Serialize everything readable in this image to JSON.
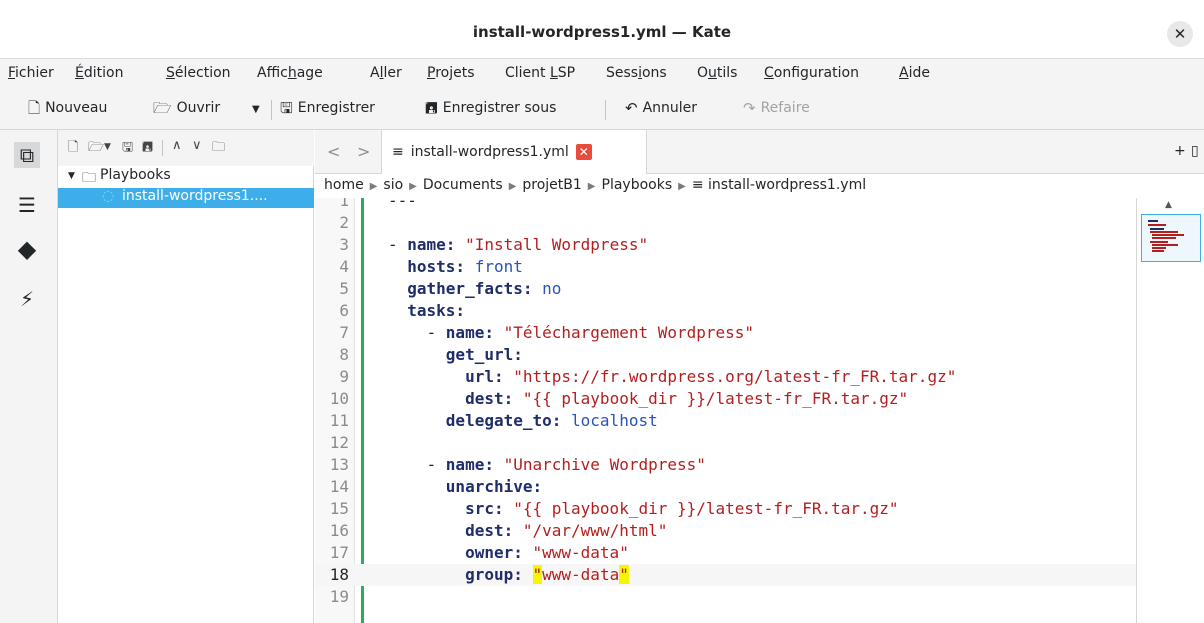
{
  "window": {
    "title": "install-wordpress1.yml — Kate"
  },
  "menubar": [
    {
      "pre": "",
      "ul": "F",
      "post": "ichier"
    },
    {
      "pre": "",
      "ul": "É",
      "post": "dition"
    },
    {
      "pre": "",
      "ul": "S",
      "post": "élection"
    },
    {
      "pre": "Affic",
      "ul": "h",
      "post": "age"
    },
    {
      "pre": "A",
      "ul": "l",
      "post": "ler"
    },
    {
      "pre": "",
      "ul": "P",
      "post": "rojets"
    },
    {
      "pre": "Client ",
      "ul": "L",
      "post": "SP"
    },
    {
      "pre": "Sess",
      "ul": "i",
      "post": "ons"
    },
    {
      "pre": "O",
      "ul": "u",
      "post": "tils"
    },
    {
      "pre": "",
      "ul": "C",
      "post": "onfiguration"
    },
    {
      "pre": "",
      "ul": "A",
      "post": "ide"
    }
  ],
  "toolbar": {
    "new_label": "Nouveau",
    "open_label": "Ouvrir",
    "save_label": "Enregistrer",
    "save_as_label": "Enregistrer sous",
    "undo_label": "Annuler",
    "redo_label": "Refaire"
  },
  "tree": {
    "folder": "Playbooks",
    "file": "install-wordpress1...."
  },
  "tab": {
    "label": "install-wordpress1.yml"
  },
  "breadcrumb": [
    "home",
    "sio",
    "Documents",
    "projetB1",
    "Playbooks",
    "install-wordpress1.yml"
  ],
  "editor": {
    "current_line": 18,
    "lines": [
      [
        {
          "t": "---",
          "c": "p"
        }
      ],
      [],
      [
        {
          "t": "- ",
          "c": "p"
        },
        {
          "t": "name:",
          "c": "k"
        },
        {
          "t": " \"Install Wordpress\"",
          "c": "s"
        }
      ],
      [
        {
          "t": "  hosts:",
          "c": "k"
        },
        {
          "t": " front",
          "c": "v"
        }
      ],
      [
        {
          "t": "  gather_facts:",
          "c": "k"
        },
        {
          "t": " no",
          "c": "v"
        }
      ],
      [
        {
          "t": "  tasks:",
          "c": "k"
        }
      ],
      [
        {
          "t": "    - ",
          "c": "p"
        },
        {
          "t": "name:",
          "c": "k"
        },
        {
          "t": " \"Téléchargement Wordpress\"",
          "c": "s"
        }
      ],
      [
        {
          "t": "      get_url:",
          "c": "k"
        }
      ],
      [
        {
          "t": "        url:",
          "c": "k"
        },
        {
          "t": " \"https://fr.wordpress.org/latest-fr_FR.tar.gz\"",
          "c": "s"
        }
      ],
      [
        {
          "t": "        dest:",
          "c": "k"
        },
        {
          "t": " \"{{ playbook_dir }}/latest-fr_FR.tar.gz\"",
          "c": "s"
        }
      ],
      [
        {
          "t": "      delegate_to:",
          "c": "k"
        },
        {
          "t": " localhost",
          "c": "v"
        }
      ],
      [],
      [
        {
          "t": "    - ",
          "c": "p"
        },
        {
          "t": "name:",
          "c": "k"
        },
        {
          "t": " \"Unarchive Wordpress\"",
          "c": "s"
        }
      ],
      [
        {
          "t": "      unarchive:",
          "c": "k"
        }
      ],
      [
        {
          "t": "        src:",
          "c": "k"
        },
        {
          "t": " \"{{ playbook_dir }}/latest-fr_FR.tar.gz\"",
          "c": "s"
        }
      ],
      [
        {
          "t": "        dest:",
          "c": "k"
        },
        {
          "t": " \"/var/www/html\"",
          "c": "s"
        }
      ],
      [
        {
          "t": "        owner:",
          "c": "k"
        },
        {
          "t": " \"www-data\"",
          "c": "s"
        }
      ],
      [
        {
          "t": "        group:",
          "c": "k"
        },
        {
          "t": " ",
          "c": "p"
        },
        {
          "t": "\"",
          "c": "s hl"
        },
        {
          "t": "www-data",
          "c": "s"
        },
        {
          "t": "\"",
          "c": "s hl"
        }
      ],
      []
    ]
  },
  "colors": {
    "accent": "#3daee9",
    "change_marker": "#27ae60",
    "tab_close": "#e74c3c",
    "bracket_highlight": "#f5f600"
  }
}
